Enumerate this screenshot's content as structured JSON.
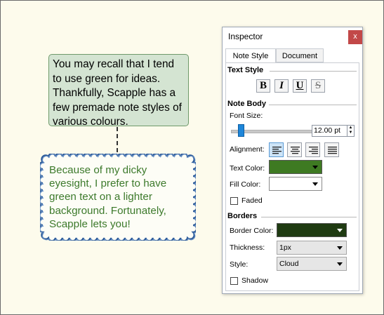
{
  "canvas": {
    "note1_text": "You may recall that I tend to use green for ideas. Thankfully, Scapple has a few premade note styles of various colours.",
    "note2_text": "Because of my dicky eyesight, I prefer to have green text on a lighter background. Fortunately, Scapple lets you!",
    "note1_color": "#d4e4d2",
    "note2_text_color": "#3d7a2c",
    "note2_border_color": "#2e5c9a"
  },
  "inspector": {
    "title": "Inspector",
    "close_label": "x",
    "tabs": [
      "Note Style",
      "Document"
    ],
    "text_style": {
      "heading": "Text Style",
      "bold": "B",
      "italic": "I",
      "underline": "U",
      "strike": "S"
    },
    "note_body": {
      "heading": "Note Body",
      "font_size_label": "Font Size:",
      "font_size_value": "12.00 pt",
      "alignment_label": "Alignment:",
      "alignments": [
        "align-left-icon",
        "align-center-icon",
        "align-right-icon",
        "align-justify-icon"
      ],
      "text_color_label": "Text Color:",
      "text_color": "#3e7a22",
      "fill_color_label": "Fill Color:",
      "fill_color": "#ffffff",
      "faded_label": "Faded"
    },
    "borders": {
      "heading": "Borders",
      "border_color_label": "Border Color:",
      "border_color": "#1f3b12",
      "thickness_label": "Thickness:",
      "thickness_value": "1px",
      "style_label": "Style:",
      "style_value": "Cloud",
      "shadow_label": "Shadow"
    }
  }
}
